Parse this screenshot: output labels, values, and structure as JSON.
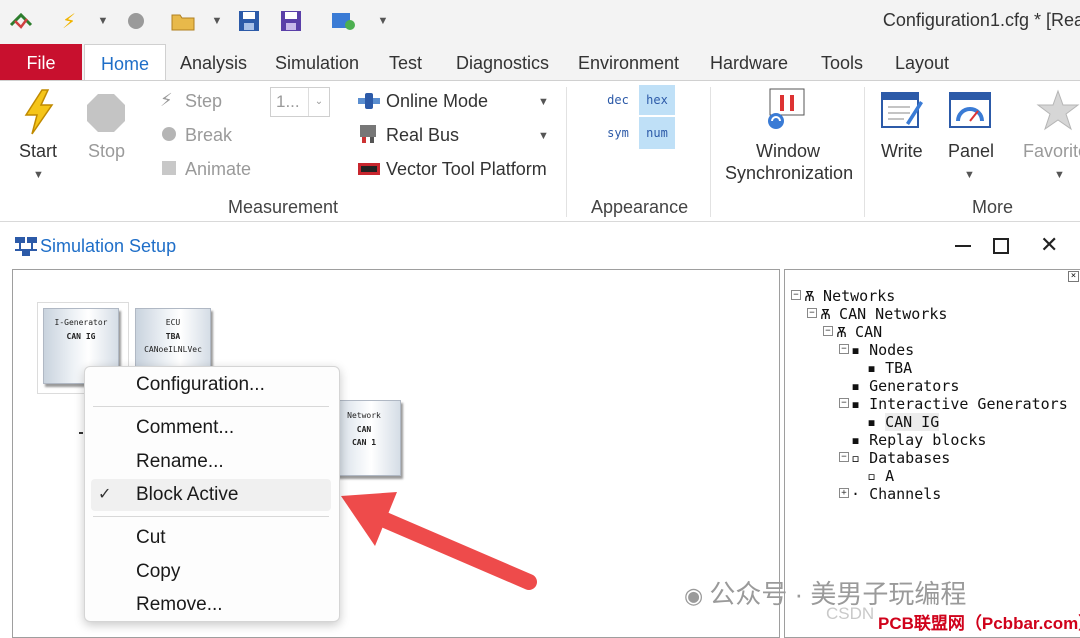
{
  "app": {
    "document_title": "Configuration1.cfg * [Rea"
  },
  "ribbon_tabs": [
    "File",
    "Home",
    "Analysis",
    "Simulation",
    "Test",
    "Diagnostics",
    "Environment",
    "Hardware",
    "Tools",
    "Layout"
  ],
  "ribbon": {
    "measurement": {
      "start": "Start",
      "stop": "Stop",
      "step": "Step",
      "break": "Break",
      "animate": "Animate",
      "step_value": "1...",
      "online_mode": "Online Mode",
      "real_bus": "Real Bus",
      "vector_tool_platform": "Vector Tool Platform",
      "group_label": "Measurement"
    },
    "appearance": {
      "dec": "dec",
      "hex": "hex",
      "sym": "sym",
      "num": "num",
      "group_label": "Appearance"
    },
    "more": {
      "window_sync_1": "Window",
      "window_sync_2": "Synchronization",
      "write": "Write",
      "panel": "Panel",
      "favorites": "Favorite",
      "group_label": "More"
    }
  },
  "sim_window": {
    "title": "Simulation Setup"
  },
  "blocks": {
    "ig": {
      "line1": "I-Generator",
      "line2": "CAN IG"
    },
    "ecu": {
      "line1": "ECU",
      "line2": "TBA",
      "line3": "CANoeILNLVec"
    },
    "network": {
      "line1": "Network",
      "line2": "CAN",
      "line3": "CAN 1"
    }
  },
  "context_menu": {
    "items": [
      "Configuration...",
      "Comment...",
      "Rename...",
      "Block Active",
      "Cut",
      "Copy",
      "Remove..."
    ],
    "checked": "Block Active"
  },
  "tree": {
    "networks": "Networks",
    "can_networks": "CAN Networks",
    "can": "CAN",
    "nodes": "Nodes",
    "tba": "TBA",
    "generators": "Generators",
    "interactive_generators": "Interactive Generators",
    "can_ig": "CAN IG",
    "replay_blocks": "Replay blocks",
    "databases": "Databases",
    "db_a": "A",
    "channels": "Channels"
  },
  "watermark": {
    "wechat": "公众号 · 美男子玩编程",
    "site": "PCB联盟网（Pcbbar.com）",
    "csdn": "CSDN"
  },
  "colors": {
    "accent": "#1e6ec8",
    "file_tab": "#c8102e",
    "arrow": "#ee4b4b",
    "selected_hex": "#bfe0f7"
  }
}
